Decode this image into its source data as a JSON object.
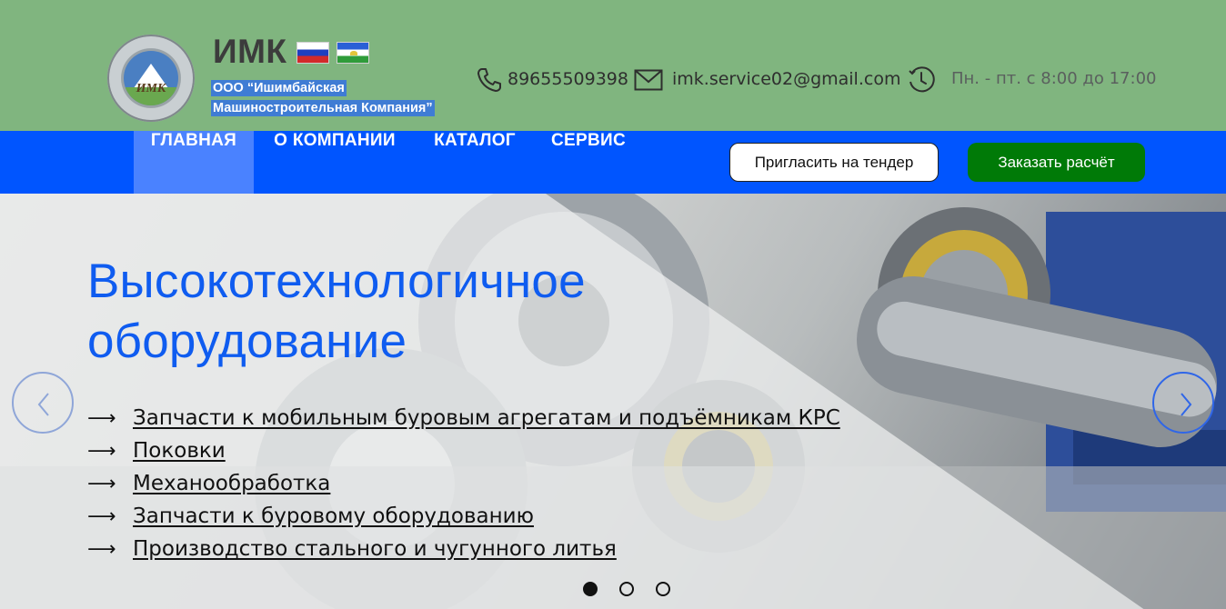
{
  "header": {
    "brand": "ИМК",
    "company_line1": "ООО “Ишимбайская",
    "company_line2": "Машиностроительная Компания”",
    "logo_text": "ИМК",
    "phone": "89655509398",
    "email": "imk.service02@gmail.com",
    "hours": "Пн. - пт. с 8:00 до 17:00",
    "icons": [
      "phone-icon",
      "mail-icon",
      "clock-icon"
    ],
    "flags": [
      "russia-flag",
      "bashkortostan-flag"
    ]
  },
  "nav": {
    "items": [
      {
        "label": "ГЛАВНАЯ",
        "active": true
      },
      {
        "label": "О КОМПАНИИ",
        "active": false
      },
      {
        "label": "КАТАЛОГ",
        "active": false
      },
      {
        "label": "СЕРВИС",
        "active": false
      }
    ],
    "tender_button": "Пригласить на тендер",
    "order_button": "Заказать расчёт"
  },
  "hero": {
    "title_line1": "Высокотехнологичное",
    "title_line2": "оборудование",
    "arrow_glyph": "⟶",
    "links": [
      "Запчасти к мобильным буровым агрегатам и подъёмникам КРС",
      "Поковки",
      "Механообработка",
      "Запчасти к буровому оборудованию",
      "Производство стального и чугунного литья"
    ],
    "slides": {
      "count": 3,
      "active": 1
    }
  },
  "colors": {
    "header_bg": "#80b57f",
    "nav_bg": "#0055ff",
    "nav_active": "#4a82ff",
    "title_blue": "#0f5cf0",
    "order_green": "#007a07",
    "company_highlight": "#3f7cd4"
  }
}
